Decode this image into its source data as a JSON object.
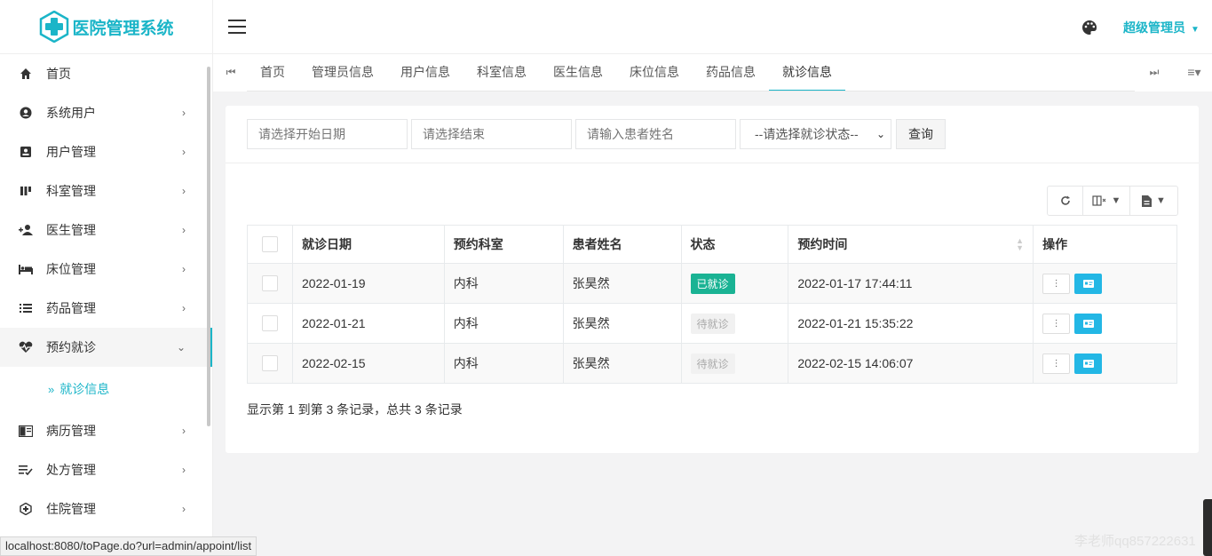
{
  "app": {
    "title": "医院管理系统"
  },
  "header": {
    "user": "超级管理员"
  },
  "sidebar": {
    "items": [
      {
        "label": "首页",
        "icon": "home-icon"
      },
      {
        "label": "系统用户",
        "icon": "user-circle-icon"
      },
      {
        "label": "用户管理",
        "icon": "id-card-icon"
      },
      {
        "label": "科室管理",
        "icon": "columns-icon"
      },
      {
        "label": "医生管理",
        "icon": "user-plus-icon"
      },
      {
        "label": "床位管理",
        "icon": "bed-icon"
      },
      {
        "label": "药品管理",
        "icon": "list-icon"
      },
      {
        "label": "预约就诊",
        "icon": "heartbeat-icon"
      },
      {
        "label": "病历管理",
        "icon": "book-icon"
      },
      {
        "label": "处方管理",
        "icon": "list-check-icon"
      },
      {
        "label": "住院管理",
        "icon": "hospital-icon"
      }
    ],
    "sub_item": "就诊信息"
  },
  "tabs": [
    "首页",
    "管理员信息",
    "用户信息",
    "科室信息",
    "医生信息",
    "床位信息",
    "药品信息",
    "就诊信息"
  ],
  "filters": {
    "start_placeholder": "请选择开始日期",
    "end_placeholder": "请选择结束",
    "name_placeholder": "请输入患者姓名",
    "status_select": "--请选择就诊状态--",
    "query_label": "查询"
  },
  "table": {
    "headers": [
      "就诊日期",
      "预约科室",
      "患者姓名",
      "状态",
      "预约时间",
      "操作"
    ],
    "rows": [
      {
        "date": "2022-01-19",
        "dept": "内科",
        "name": "张昊然",
        "status": "已就诊",
        "time": "2022-01-17 17:44:11"
      },
      {
        "date": "2022-01-21",
        "dept": "内科",
        "name": "张昊然",
        "status": "待就诊",
        "time": "2022-01-21 15:35:22"
      },
      {
        "date": "2022-02-15",
        "dept": "内科",
        "name": "张昊然",
        "status": "待就诊",
        "time": "2022-02-15 14:06:07"
      }
    ]
  },
  "pager": {
    "summary": "显示第 1 到第 3 条记录，总共 3 条记录"
  },
  "statusbar": {
    "url": "localhost:8080/toPage.do?url=admin/appoint/list"
  },
  "watermark": "李老师qq857222631",
  "colors": {
    "accent": "#1bb5c8",
    "done": "#1ab394",
    "info": "#23b7e5"
  }
}
